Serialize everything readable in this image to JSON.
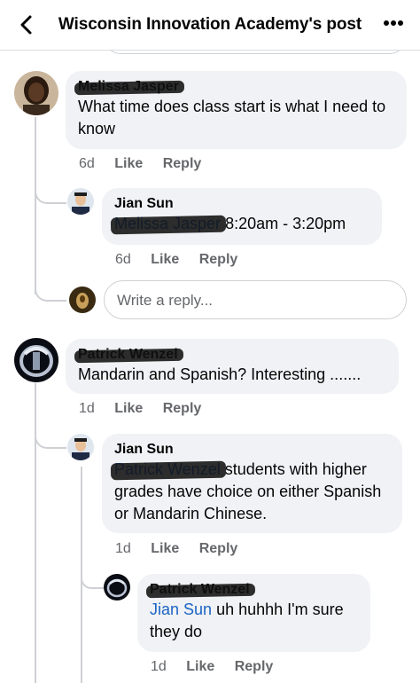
{
  "header": {
    "title": "Wisconsin Innovation Academy's post"
  },
  "comments": [
    {
      "author": "Melissa Jasper",
      "text": "What time does class start is what I need to know",
      "time": "6d",
      "like": "Like",
      "reply": "Reply",
      "replies": [
        {
          "author": "Jian Sun",
          "mention": "Melissa Jasper",
          "text": "8:20am - 3:20pm",
          "time": "6d",
          "like": "Like",
          "reply": "Reply"
        }
      ]
    },
    {
      "author": "Patrick Wenzel",
      "text": "Mandarin and Spanish? Interesting  .......",
      "time": "1d",
      "like": "Like",
      "reply": "Reply",
      "replies": [
        {
          "author": "Jian Sun",
          "mention": "Patrick Wenzel",
          "text": "students with higher grades have choice on either Spanish or Mandarin Chinese.",
          "time": "1d",
          "like": "Like",
          "reply": "Reply"
        },
        {
          "author": "Patrick Wenzel",
          "mention": "Jian Sun",
          "text": "uh huhhh I'm sure they do",
          "time": "1d",
          "like": "Like",
          "reply": "Reply"
        }
      ]
    }
  ],
  "reply_input": {
    "placeholder": "Write a reply..."
  },
  "colors": {
    "link": "#1c64c4",
    "bubble": "#f0f2f5",
    "meta": "#65676b"
  }
}
